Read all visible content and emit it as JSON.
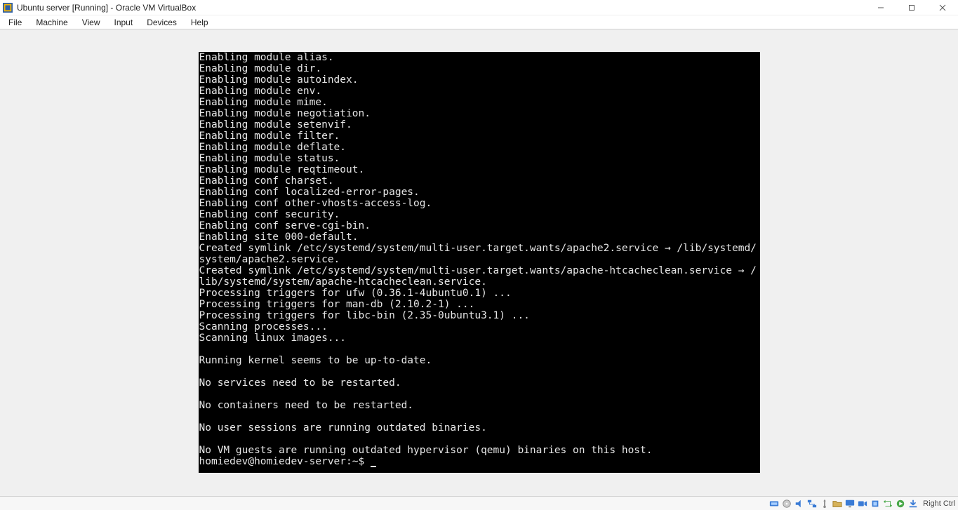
{
  "titlebar": {
    "title": "Ubuntu server [Running] - Oracle VM VirtualBox"
  },
  "menubar": {
    "items": [
      "File",
      "Machine",
      "View",
      "Input",
      "Devices",
      "Help"
    ]
  },
  "terminal": {
    "lines": [
      "Enabling module alias.",
      "Enabling module dir.",
      "Enabling module autoindex.",
      "Enabling module env.",
      "Enabling module mime.",
      "Enabling module negotiation.",
      "Enabling module setenvif.",
      "Enabling module filter.",
      "Enabling module deflate.",
      "Enabling module status.",
      "Enabling module reqtimeout.",
      "Enabling conf charset.",
      "Enabling conf localized-error-pages.",
      "Enabling conf other-vhosts-access-log.",
      "Enabling conf security.",
      "Enabling conf serve-cgi-bin.",
      "Enabling site 000-default.",
      "Created symlink /etc/systemd/system/multi-user.target.wants/apache2.service → /lib/systemd/system/apache2.service.",
      "Created symlink /etc/systemd/system/multi-user.target.wants/apache-htcacheclean.service → /lib/systemd/system/apache-htcacheclean.service.",
      "Processing triggers for ufw (0.36.1-4ubuntu0.1) ...",
      "Processing triggers for man-db (2.10.2-1) ...",
      "Processing triggers for libc-bin (2.35-0ubuntu3.1) ...",
      "Scanning processes...",
      "Scanning linux images...",
      "",
      "Running kernel seems to be up-to-date.",
      "",
      "No services need to be restarted.",
      "",
      "No containers need to be restarted.",
      "",
      "No user sessions are running outdated binaries.",
      "",
      "No VM guests are running outdated hypervisor (qemu) binaries on this host."
    ],
    "prompt": "homiedev@homiedev-server:~$ "
  },
  "statusbar": {
    "hostkey": "Right Ctrl",
    "icons": [
      "hard-disk-icon",
      "optical-disc-icon",
      "audio-icon",
      "network-icon",
      "usb-icon",
      "shared-folders-icon",
      "display-icon",
      "recording-icon",
      "cpu-icon",
      "capture-icon",
      "vm-state-icon",
      "hostkey-indicator-icon"
    ]
  }
}
